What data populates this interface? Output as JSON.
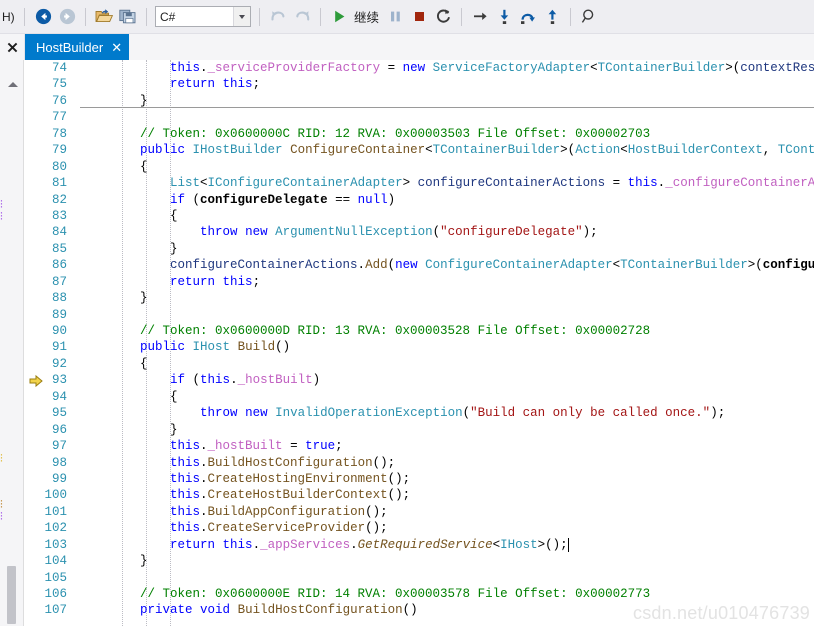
{
  "toolbar": {
    "menu_tail": "H)",
    "nav_back_title": "Navigate Backward",
    "nav_forward_title": "Navigate Forward",
    "open_title": "Open File",
    "save_title": "Save All",
    "language_combo": {
      "value": "C#",
      "placeholder": "C#"
    },
    "undo_title": "Undo",
    "redo_title": "Redo",
    "continue_label": "继续",
    "pause_title": "Break All",
    "stop_title": "Stop Debugging",
    "restart_title": "Restart",
    "show_next_statement_title": "Show Next Statement",
    "step_into_title": "Step Into",
    "step_over_title": "Step Over",
    "step_out_title": "Step Out",
    "search_title": "Quick Find"
  },
  "tabs": {
    "dock_close_label": "✕",
    "active": {
      "label": "HostBuilder",
      "close_label": "✕"
    }
  },
  "editor": {
    "current_execution_line": 93,
    "caret_line": 103,
    "highlight_color": "#fff5a0",
    "lines": [
      {
        "n": 74,
        "tokens": [
          {
            "t": "            ",
            "c": "p"
          },
          {
            "t": "this",
            "c": "k"
          },
          {
            "t": ".",
            "c": "p"
          },
          {
            "t": "_serviceProviderFactory",
            "c": "fld"
          },
          {
            "t": " = ",
            "c": "p"
          },
          {
            "t": "new",
            "c": "k"
          },
          {
            "t": " ",
            "c": "p"
          },
          {
            "t": "ServiceFactoryAdapter",
            "c": "t"
          },
          {
            "t": "<",
            "c": "p"
          },
          {
            "t": "TContainerBuilder",
            "c": "t"
          },
          {
            "t": ">",
            "c": "p"
          },
          {
            "t": "(",
            "c": "p"
          },
          {
            "t": "contextReso",
            "c": "id"
          }
        ]
      },
      {
        "n": 75,
        "tokens": [
          {
            "t": "            ",
            "c": "p"
          },
          {
            "t": "return",
            "c": "k"
          },
          {
            "t": " ",
            "c": "p"
          },
          {
            "t": "this",
            "c": "k"
          },
          {
            "t": ";",
            "c": "p"
          }
        ]
      },
      {
        "n": 76,
        "tokens": [
          {
            "t": "        }",
            "c": "p"
          }
        ]
      },
      {
        "n": 77,
        "tokens": []
      },
      {
        "n": 78,
        "tokens": [
          {
            "t": "        // Token: 0x0600000C RID: 12 RVA: 0x00003503 File Offset: 0x00002703",
            "c": "c"
          }
        ]
      },
      {
        "n": 79,
        "tokens": [
          {
            "t": "        ",
            "c": "p"
          },
          {
            "t": "public",
            "c": "k"
          },
          {
            "t": " ",
            "c": "p"
          },
          {
            "t": "IHostBuilder",
            "c": "t"
          },
          {
            "t": " ",
            "c": "p"
          },
          {
            "t": "ConfigureContainer",
            "c": "m"
          },
          {
            "t": "<",
            "c": "p"
          },
          {
            "t": "TContainerBuilder",
            "c": "t"
          },
          {
            "t": ">",
            "c": "p"
          },
          {
            "t": "(",
            "c": "p"
          },
          {
            "t": "Action",
            "c": "t"
          },
          {
            "t": "<",
            "c": "p"
          },
          {
            "t": "HostBuilderContext",
            "c": "t"
          },
          {
            "t": ", ",
            "c": "p"
          },
          {
            "t": "TConta",
            "c": "t"
          }
        ]
      },
      {
        "n": 80,
        "tokens": [
          {
            "t": "        {",
            "c": "p"
          }
        ]
      },
      {
        "n": 81,
        "tokens": [
          {
            "t": "            ",
            "c": "p"
          },
          {
            "t": "List",
            "c": "t"
          },
          {
            "t": "<",
            "c": "p"
          },
          {
            "t": "IConfigureContainerAdapter",
            "c": "t"
          },
          {
            "t": "> ",
            "c": "p"
          },
          {
            "t": "configureContainerActions",
            "c": "id"
          },
          {
            "t": " = ",
            "c": "p"
          },
          {
            "t": "this",
            "c": "k"
          },
          {
            "t": ".",
            "c": "p"
          },
          {
            "t": "_configureContainerAc",
            "c": "fld"
          }
        ]
      },
      {
        "n": 82,
        "tokens": [
          {
            "t": "            ",
            "c": "p"
          },
          {
            "t": "if",
            "c": "k"
          },
          {
            "t": " (",
            "c": "p"
          },
          {
            "t": "configureDelegate",
            "c": "b"
          },
          {
            "t": " == ",
            "c": "p"
          },
          {
            "t": "null",
            "c": "k"
          },
          {
            "t": ")",
            "c": "p"
          }
        ]
      },
      {
        "n": 83,
        "tokens": [
          {
            "t": "            {",
            "c": "p"
          }
        ]
      },
      {
        "n": 84,
        "tokens": [
          {
            "t": "                ",
            "c": "p"
          },
          {
            "t": "throw",
            "c": "k"
          },
          {
            "t": " ",
            "c": "p"
          },
          {
            "t": "new",
            "c": "k"
          },
          {
            "t": " ",
            "c": "p"
          },
          {
            "t": "ArgumentNullException",
            "c": "t"
          },
          {
            "t": "(",
            "c": "p"
          },
          {
            "t": "\"configureDelegate\"",
            "c": "s"
          },
          {
            "t": ");",
            "c": "p"
          }
        ]
      },
      {
        "n": 85,
        "tokens": [
          {
            "t": "            }",
            "c": "p"
          }
        ]
      },
      {
        "n": 86,
        "tokens": [
          {
            "t": "            ",
            "c": "p"
          },
          {
            "t": "configureContainerActions",
            "c": "id"
          },
          {
            "t": ".",
            "c": "p"
          },
          {
            "t": "Add",
            "c": "m"
          },
          {
            "t": "(",
            "c": "p"
          },
          {
            "t": "new",
            "c": "k"
          },
          {
            "t": " ",
            "c": "p"
          },
          {
            "t": "ConfigureContainerAdapter",
            "c": "t"
          },
          {
            "t": "<",
            "c": "p"
          },
          {
            "t": "TContainerBuilder",
            "c": "t"
          },
          {
            "t": ">",
            "c": "p"
          },
          {
            "t": "(",
            "c": "p"
          },
          {
            "t": "configu",
            "c": "b"
          }
        ]
      },
      {
        "n": 87,
        "tokens": [
          {
            "t": "            ",
            "c": "p"
          },
          {
            "t": "return",
            "c": "k"
          },
          {
            "t": " ",
            "c": "p"
          },
          {
            "t": "this",
            "c": "k"
          },
          {
            "t": ";",
            "c": "p"
          }
        ]
      },
      {
        "n": 88,
        "tokens": [
          {
            "t": "        }",
            "c": "p"
          }
        ]
      },
      {
        "n": 89,
        "tokens": []
      },
      {
        "n": 90,
        "tokens": [
          {
            "t": "        // Token: 0x0600000D RID: 13 RVA: 0x00003528 File Offset: 0x00002728",
            "c": "c"
          }
        ]
      },
      {
        "n": 91,
        "tokens": [
          {
            "t": "        ",
            "c": "p"
          },
          {
            "t": "public",
            "c": "k"
          },
          {
            "t": " ",
            "c": "p"
          },
          {
            "t": "IHost",
            "c": "t"
          },
          {
            "t": " ",
            "c": "p"
          },
          {
            "t": "Build",
            "c": "m"
          },
          {
            "t": "()",
            "c": "p"
          }
        ]
      },
      {
        "n": 92,
        "tokens": [
          {
            "t": "        {",
            "c": "p"
          }
        ]
      },
      {
        "n": 93,
        "tokens": [
          {
            "t": "            ",
            "c": "p"
          },
          {
            "t": "if",
            "c": "k"
          },
          {
            "t": " (",
            "c": "p"
          },
          {
            "t": "this",
            "c": "k"
          },
          {
            "t": ".",
            "c": "p"
          },
          {
            "t": "_hostBuilt",
            "c": "fld"
          },
          {
            "t": ")",
            "c": "p"
          }
        ]
      },
      {
        "n": 94,
        "tokens": [
          {
            "t": "            {",
            "c": "p"
          }
        ]
      },
      {
        "n": 95,
        "tokens": [
          {
            "t": "                ",
            "c": "p"
          },
          {
            "t": "throw",
            "c": "k"
          },
          {
            "t": " ",
            "c": "p"
          },
          {
            "t": "new",
            "c": "k"
          },
          {
            "t": " ",
            "c": "p"
          },
          {
            "t": "InvalidOperationException",
            "c": "t"
          },
          {
            "t": "(",
            "c": "p"
          },
          {
            "t": "\"Build can only be called once.\"",
            "c": "s"
          },
          {
            "t": ");",
            "c": "p"
          }
        ]
      },
      {
        "n": 96,
        "tokens": [
          {
            "t": "            }",
            "c": "p"
          }
        ]
      },
      {
        "n": 97,
        "tokens": [
          {
            "t": "            ",
            "c": "p"
          },
          {
            "t": "this",
            "c": "k"
          },
          {
            "t": ".",
            "c": "p"
          },
          {
            "t": "_hostBuilt",
            "c": "fld"
          },
          {
            "t": " = ",
            "c": "p"
          },
          {
            "t": "true",
            "c": "k"
          },
          {
            "t": ";",
            "c": "p"
          }
        ]
      },
      {
        "n": 98,
        "tokens": [
          {
            "t": "            ",
            "c": "p"
          },
          {
            "t": "this",
            "c": "k"
          },
          {
            "t": ".",
            "c": "p"
          },
          {
            "t": "BuildHostConfiguration",
            "c": "m"
          },
          {
            "t": "();",
            "c": "p"
          }
        ]
      },
      {
        "n": 99,
        "tokens": [
          {
            "t": "            ",
            "c": "p"
          },
          {
            "t": "this",
            "c": "k"
          },
          {
            "t": ".",
            "c": "p"
          },
          {
            "t": "CreateHostingEnvironment",
            "c": "m"
          },
          {
            "t": "();",
            "c": "p"
          }
        ]
      },
      {
        "n": 100,
        "tokens": [
          {
            "t": "            ",
            "c": "p"
          },
          {
            "t": "this",
            "c": "k"
          },
          {
            "t": ".",
            "c": "p"
          },
          {
            "t": "CreateHostBuilderContext",
            "c": "m"
          },
          {
            "t": "();",
            "c": "p"
          }
        ]
      },
      {
        "n": 101,
        "tokens": [
          {
            "t": "            ",
            "c": "p"
          },
          {
            "t": "this",
            "c": "k"
          },
          {
            "t": ".",
            "c": "p"
          },
          {
            "t": "BuildAppConfiguration",
            "c": "m"
          },
          {
            "t": "();",
            "c": "p"
          }
        ]
      },
      {
        "n": 102,
        "tokens": [
          {
            "t": "            ",
            "c": "p"
          },
          {
            "t": "this",
            "c": "k"
          },
          {
            "t": ".",
            "c": "p"
          },
          {
            "t": "CreateServiceProvider",
            "c": "m"
          },
          {
            "t": "();",
            "c": "p"
          }
        ]
      },
      {
        "n": 103,
        "tokens": [
          {
            "t": "            ",
            "c": "p"
          },
          {
            "t": "return",
            "c": "k"
          },
          {
            "t": " ",
            "c": "p"
          },
          {
            "t": "this",
            "c": "k"
          },
          {
            "t": ".",
            "c": "p"
          },
          {
            "t": "_appServices",
            "c": "fld"
          },
          {
            "t": ".",
            "c": "p"
          },
          {
            "t": "GetRequiredService",
            "c": "mi"
          },
          {
            "t": "<",
            "c": "p"
          },
          {
            "t": "IHost",
            "c": "t"
          },
          {
            "t": ">();",
            "c": "p"
          }
        ]
      },
      {
        "n": 104,
        "tokens": [
          {
            "t": "        }",
            "c": "p"
          }
        ]
      },
      {
        "n": 105,
        "tokens": []
      },
      {
        "n": 106,
        "tokens": [
          {
            "t": "        // Token: 0x0600000E RID: 14 RVA: 0x00003578 File Offset: 0x00002773",
            "c": "c"
          }
        ]
      },
      {
        "n": 107,
        "tokens": [
          {
            "t": "        ",
            "c": "p"
          },
          {
            "t": "private",
            "c": "k"
          },
          {
            "t": " ",
            "c": "p"
          },
          {
            "t": "void",
            "c": "k"
          },
          {
            "t": " ",
            "c": "p"
          },
          {
            "t": "BuildHostConfiguration",
            "c": "m"
          },
          {
            "t": "()",
            "c": "p"
          }
        ]
      }
    ]
  },
  "watermark": {
    "text": "csdn.net/u010476739"
  }
}
